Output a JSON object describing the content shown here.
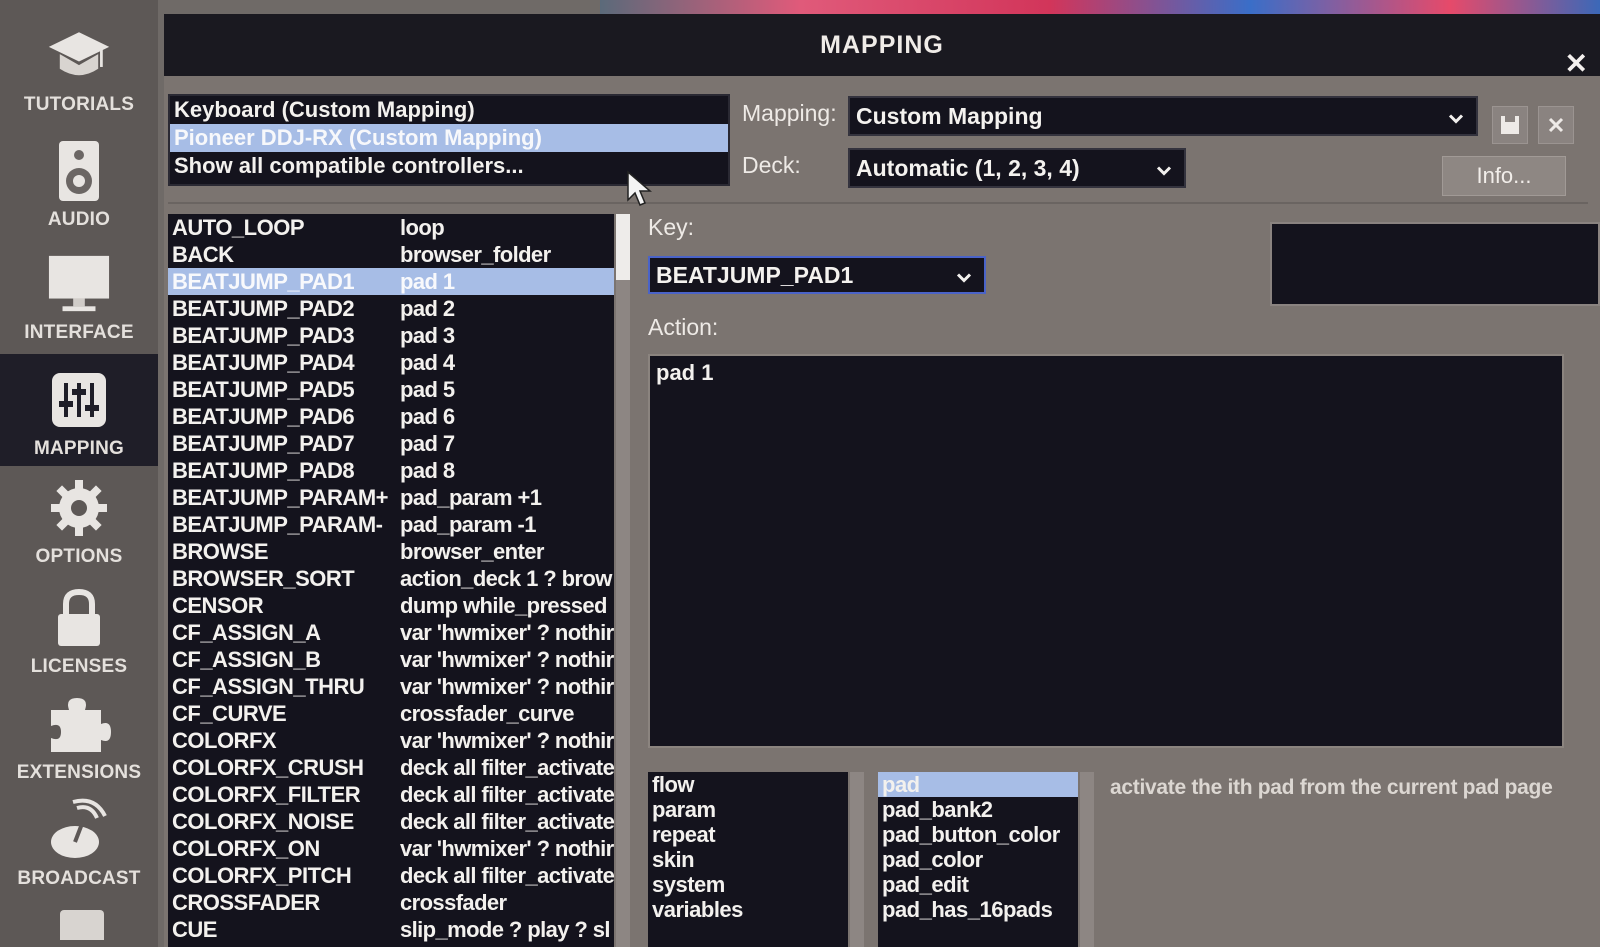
{
  "sidebar": {
    "items": [
      {
        "label": "TUTORIALS",
        "icon": "graduation-cap-icon"
      },
      {
        "label": "AUDIO",
        "icon": "speaker-icon"
      },
      {
        "label": "INTERFACE",
        "icon": "monitor-icon"
      },
      {
        "label": "MAPPING",
        "icon": "sliders-icon",
        "active": true
      },
      {
        "label": "OPTIONS",
        "icon": "gear-icon"
      },
      {
        "label": "LICENSES",
        "icon": "lock-icon"
      },
      {
        "label": "EXTENSIONS",
        "icon": "puzzle-icon"
      },
      {
        "label": "BROADCAST",
        "icon": "broadcast-icon"
      }
    ]
  },
  "dialog": {
    "title": "MAPPING",
    "close": "✕"
  },
  "controllers": [
    {
      "label": "Keyboard (Custom Mapping)",
      "selected": false
    },
    {
      "label": "Pioneer DDJ-RX (Custom Mapping)",
      "selected": true
    },
    {
      "label": "Show all compatible controllers...",
      "selected": false
    }
  ],
  "mapping": {
    "label": "Mapping:",
    "value": "Custom Mapping"
  },
  "deck": {
    "label": "Deck:",
    "value": "Automatic (1, 2, 3, 4)"
  },
  "info_button": "Info...",
  "keys": [
    {
      "name": "AUTO_LOOP",
      "action": "loop"
    },
    {
      "name": "BACK",
      "action": "browser_folder"
    },
    {
      "name": "BEATJUMP_PAD1",
      "action": "pad 1",
      "selected": true
    },
    {
      "name": "BEATJUMP_PAD2",
      "action": "pad 2"
    },
    {
      "name": "BEATJUMP_PAD3",
      "action": "pad 3"
    },
    {
      "name": "BEATJUMP_PAD4",
      "action": "pad 4"
    },
    {
      "name": "BEATJUMP_PAD5",
      "action": "pad 5"
    },
    {
      "name": "BEATJUMP_PAD6",
      "action": "pad 6"
    },
    {
      "name": "BEATJUMP_PAD7",
      "action": "pad 7"
    },
    {
      "name": "BEATJUMP_PAD8",
      "action": "pad 8"
    },
    {
      "name": "BEATJUMP_PARAM+",
      "action": "pad_param +1"
    },
    {
      "name": "BEATJUMP_PARAM-",
      "action": "pad_param -1"
    },
    {
      "name": "BROWSE",
      "action": "browser_enter"
    },
    {
      "name": "BROWSER_SORT",
      "action": "action_deck 1 ? brow"
    },
    {
      "name": "CENSOR",
      "action": "dump while_pressed"
    },
    {
      "name": "CF_ASSIGN_A",
      "action": "var 'hwmixer' ? nothir"
    },
    {
      "name": "CF_ASSIGN_B",
      "action": "var 'hwmixer' ? nothir"
    },
    {
      "name": "CF_ASSIGN_THRU",
      "action": "var 'hwmixer' ? nothir"
    },
    {
      "name": "CF_CURVE",
      "action": "crossfader_curve"
    },
    {
      "name": "COLORFX",
      "action": "var 'hwmixer' ? nothir"
    },
    {
      "name": "COLORFX_CRUSH",
      "action": "deck all filter_activate"
    },
    {
      "name": "COLORFX_FILTER",
      "action": "deck all filter_activate"
    },
    {
      "name": "COLORFX_NOISE",
      "action": "deck all filter_activate"
    },
    {
      "name": "COLORFX_ON",
      "action": "var 'hwmixer' ? nothir"
    },
    {
      "name": "COLORFX_PITCH",
      "action": "deck all filter_activate"
    },
    {
      "name": "CROSSFADER",
      "action": "crossfader"
    },
    {
      "name": "CUE",
      "action": "slip_mode ? play ? sl"
    }
  ],
  "key_field": {
    "label": "Key:",
    "value": "BEATJUMP_PAD1"
  },
  "action_field": {
    "label": "Action:",
    "value": "pad 1"
  },
  "categories": [
    "flow",
    "param",
    "repeat",
    "skin",
    "system",
    "variables"
  ],
  "functions": [
    {
      "label": "pad",
      "selected": true
    },
    {
      "label": "pad_bank2"
    },
    {
      "label": "pad_button_color"
    },
    {
      "label": "pad_color"
    },
    {
      "label": "pad_edit"
    },
    {
      "label": "pad_has_16pads"
    }
  ],
  "function_description": "activate the ith pad from the current pad page",
  "colors": {
    "selection": "#a7bde6",
    "panel_dark": "#14131d",
    "dialog_bg": "#7b7470"
  }
}
